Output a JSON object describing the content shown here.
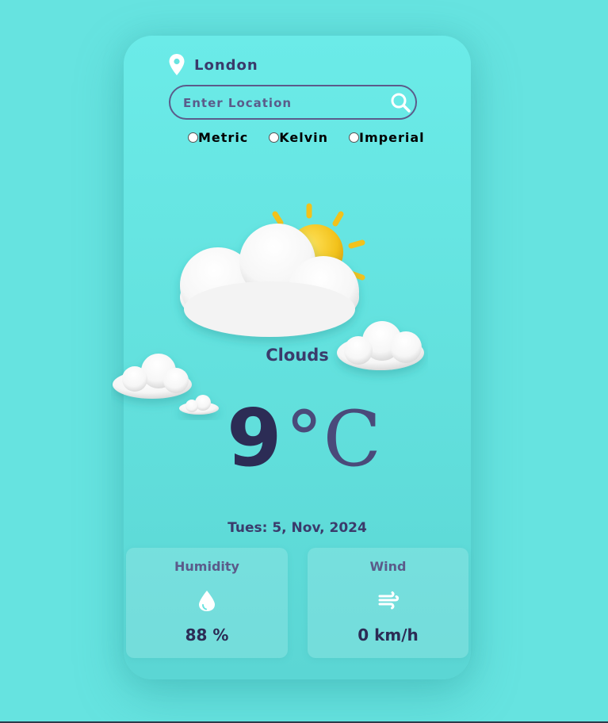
{
  "location": {
    "city": "London",
    "icon": "map-pin-icon"
  },
  "search": {
    "placeholder": "Enter Location",
    "value": "",
    "icon": "search-icon"
  },
  "units": {
    "options": [
      "Metric",
      "Kelvin",
      "Imperial"
    ],
    "selected": null
  },
  "weather": {
    "condition": "Clouds",
    "icon": "partly-cloudy-icon",
    "temperature": "9",
    "temperature_unit": "°C"
  },
  "date": "Tues: 5, Nov, 2024",
  "stats": {
    "humidity": {
      "label": "Humidity",
      "value": "88 %",
      "icon": "water-drop-icon"
    },
    "wind": {
      "label": "Wind",
      "value": "0 km/h",
      "icon": "wind-icon"
    }
  },
  "colors": {
    "background": "#66e3e0",
    "card": "#6bebe8",
    "text_dark": "#2c2c55",
    "text_muted": "#5b5b8a",
    "sun": "#f2c21b"
  }
}
